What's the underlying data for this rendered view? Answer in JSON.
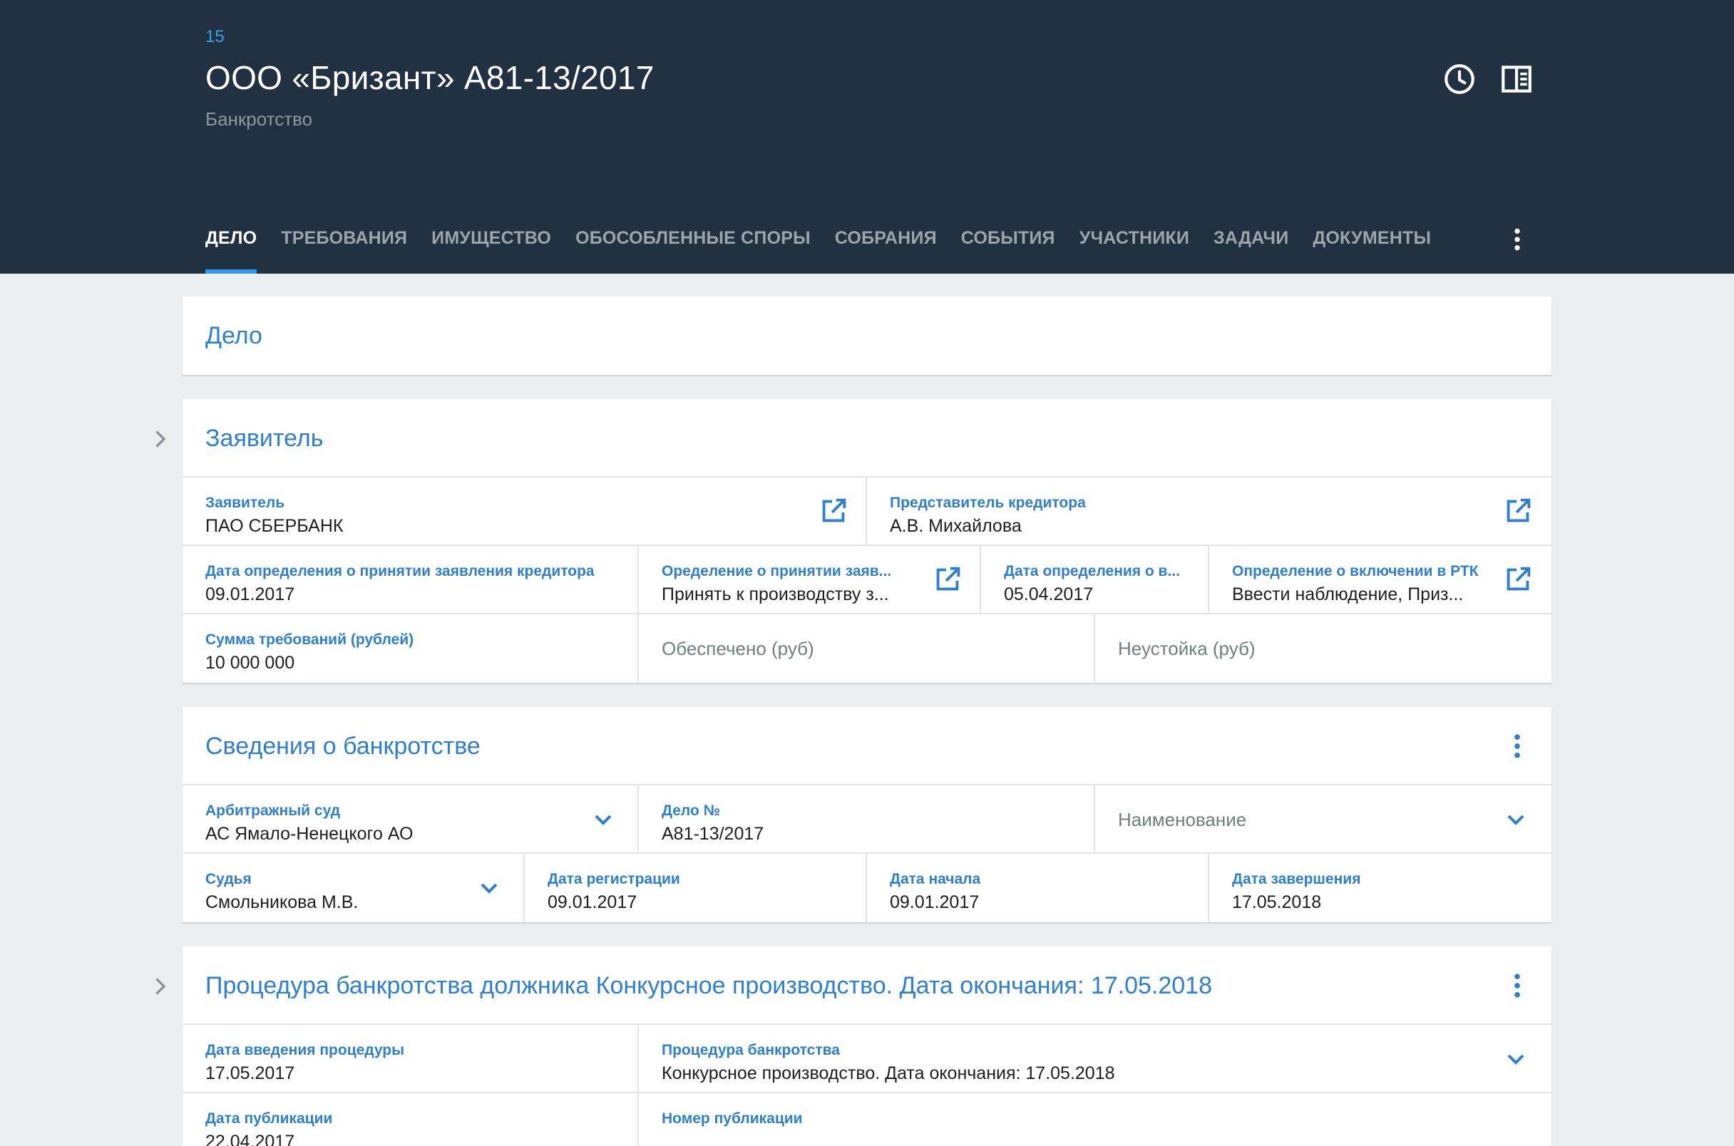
{
  "header": {
    "case_number": "15",
    "title": "ООО «Бризант» А81-13/2017",
    "subtitle": "Банкротство"
  },
  "tabs": [
    {
      "label": "ДЕЛО",
      "active": true
    },
    {
      "label": "ТРЕБОВАНИЯ"
    },
    {
      "label": "ИМУЩЕСТВО"
    },
    {
      "label": "ОБОСОБЛЕННЫЕ СПОРЫ"
    },
    {
      "label": "СОБРАНИЯ"
    },
    {
      "label": "СОБЫТИЯ"
    },
    {
      "label": "УЧАСТНИКИ"
    },
    {
      "label": "ЗАДАЧИ"
    },
    {
      "label": "ДОКУМЕНТЫ"
    }
  ],
  "sections": {
    "delo": {
      "title": "Дело"
    },
    "applicant": {
      "title": "Заявитель",
      "applicant_label": "Заявитель",
      "applicant_value": "ПАО СБЕРБАНК",
      "rep_label": "Представитель кредитора",
      "rep_value": "А.В. Михайлова",
      "date_accept_label": "Дата определения о принятии заявления кредитора",
      "date_accept_value": "09.01.2017",
      "def_accept_label": "Оределение о принятии заяв...",
      "def_accept_value": "Принять к производству з...",
      "date_def_label": "Дата определения о в...",
      "date_def_value": "05.04.2017",
      "def_include_label": "Определение о включении в РТК",
      "def_include_value": "Ввести наблюдение, Приз...",
      "claim_label": "Сумма требований (рублей)",
      "claim_value": "10 000 000",
      "secured_placeholder": "Обеспечено (руб)",
      "penalty_placeholder": "Неустойка (руб)"
    },
    "bankruptcy": {
      "title": "Сведения о банкротстве",
      "court_label": "Арбитражный суд",
      "court_value": "АС Ямало-Ненецкого АО",
      "case_label": "Дело №",
      "case_value": "А81-13/2017",
      "name_placeholder": "Наименование",
      "judge_label": "Судья",
      "judge_value": "Смольникова М.В.",
      "reg_label": "Дата регистрации",
      "reg_value": "09.01.2017",
      "start_label": "Дата начала",
      "start_value": "09.01.2017",
      "end_label": "Дата завершения",
      "end_value": "17.05.2018"
    },
    "procedure": {
      "title": "Процедура банкротства должника Конкурсное производство. Дата окончания: 17.05.2018",
      "intro_label": "Дата введения процедуры",
      "intro_value": "17.05.2017",
      "proc_label": "Процедура банкротства",
      "proc_value": "Конкурсное производство. Дата окончания: 17.05.2018",
      "pub_date_label": "Дата публикации",
      "pub_date_value": "22.04.2017",
      "pub_num_label": "Номер публикации"
    }
  },
  "icons": {
    "history": "clock-icon",
    "panel": "side-panel-icon",
    "more": "more-vert-icon",
    "open": "open-in-new-icon",
    "chevron": "chevron-down-icon",
    "expand": "chevron-right-icon"
  },
  "colors": {
    "header_bg": "#213142",
    "accent": "#2f7fd0",
    "tab_indicator": "#2f9af0",
    "page_bg": "#ebeff0"
  }
}
